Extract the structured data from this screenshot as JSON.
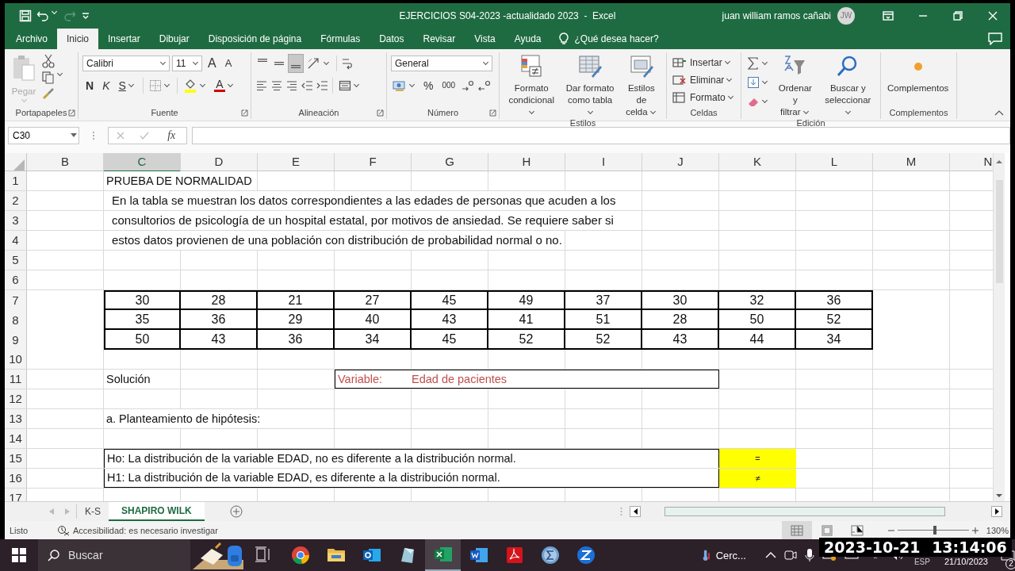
{
  "title_bar": {
    "title": "EJERCICIOS S04-2023 -actualidado 2023  -  Excel",
    "user": "juan william ramos cañabi",
    "avatar": "JW"
  },
  "menu_tabs": [
    {
      "label": "Archivo",
      "selected": false
    },
    {
      "label": "Inicio",
      "selected": true
    },
    {
      "label": "Insertar",
      "selected": false
    },
    {
      "label": "Dibujar",
      "selected": false
    },
    {
      "label": "Disposición de página",
      "selected": false
    },
    {
      "label": "Fórmulas",
      "selected": false
    },
    {
      "label": "Datos",
      "selected": false
    },
    {
      "label": "Revisar",
      "selected": false
    },
    {
      "label": "Vista",
      "selected": false
    },
    {
      "label": "Ayuda",
      "selected": false
    }
  ],
  "tell_me": "¿Qué desea hacer?",
  "ribbon": {
    "groups": [
      {
        "kind": "clipboard",
        "label": "Portapapeles",
        "paste": "Pegar",
        "disabled": true
      },
      {
        "kind": "font",
        "label": "Fuente",
        "font": "Calibri",
        "size": "11",
        "grow": "A",
        "shrink": "A",
        "bold": "N",
        "italic": "K",
        "underline": "S",
        "font_color": "A"
      },
      {
        "kind": "alignment",
        "label": "Alineación",
        "vertical_align": [
          {
            "selected": false
          },
          {
            "selected": false
          },
          {
            "selected": true
          }
        ]
      },
      {
        "kind": "number",
        "label": "Número",
        "format": "General",
        "percent": "%",
        "thousands": "000"
      },
      {
        "kind": "big_buttons",
        "label": "Estilos",
        "buttons": [
          "Formato\ncondicional",
          "Dar formato\ncomo tabla",
          "Estilos de\ncelda"
        ]
      },
      {
        "kind": "cells",
        "label": "Celdas",
        "buttons": [
          "Insertar",
          "Eliminar",
          "Formato"
        ]
      },
      {
        "kind": "editing",
        "label": "Edición",
        "buttons": [
          "Ordenar y\nfiltrar",
          "Buscar y\nseleccionar"
        ]
      },
      {
        "kind": "addins",
        "label": "Complementos",
        "buttons": [
          "Complementos"
        ]
      }
    ]
  },
  "formula_bar": {
    "name_box": "C30",
    "function_button": "fx"
  },
  "sheet": {
    "columns": [
      {
        "label": "B",
        "selected": false
      },
      {
        "label": "C",
        "selected": true
      },
      {
        "label": "D",
        "selected": false
      },
      {
        "label": "E",
        "selected": false
      },
      {
        "label": "F",
        "selected": false
      },
      {
        "label": "G",
        "selected": false
      },
      {
        "label": "H",
        "selected": false
      },
      {
        "label": "I",
        "selected": false
      },
      {
        "label": "J",
        "selected": false
      },
      {
        "label": "K",
        "selected": false
      },
      {
        "label": "L",
        "selected": false
      },
      {
        "label": "M",
        "selected": false
      },
      {
        "label": "N",
        "selected": false
      }
    ],
    "rows": [
      {
        "number": "1",
        "kind": "title",
        "text": "PRUEBA DE NORMALIDAD"
      },
      {
        "number": "2",
        "kind": "paragraph",
        "text": "En la tabla se muestran los datos correspondientes a las edades de personas que acuden a los"
      },
      {
        "number": "3",
        "kind": "paragraph",
        "text": "consultorios de psicología de un hospital estatal, por motivos de ansiedad. Se requiere saber si"
      },
      {
        "number": "4",
        "kind": "paragraph",
        "text": "estos datos provienen de una población con distribución de probabilidad normal o no."
      },
      {
        "number": "5",
        "kind": "empty"
      },
      {
        "number": "6",
        "kind": "empty"
      },
      {
        "number": "7",
        "kind": "numbers",
        "values": [
          "30",
          "28",
          "21",
          "27",
          "45",
          "49",
          "37",
          "30",
          "32",
          "36"
        ]
      },
      {
        "number": "8",
        "kind": "numbers",
        "values": [
          "35",
          "36",
          "29",
          "40",
          "43",
          "41",
          "51",
          "28",
          "50",
          "52"
        ]
      },
      {
        "number": "9",
        "kind": "numbers",
        "values": [
          "50",
          "43",
          "36",
          "34",
          "45",
          "52",
          "52",
          "43",
          "44",
          "34"
        ]
      },
      {
        "number": "10",
        "kind": "empty"
      },
      {
        "number": "11",
        "kind": "variable",
        "text": "Solución",
        "variable_label": "Variable:",
        "variable_value": "Edad de pacientes"
      },
      {
        "number": "12",
        "kind": "empty"
      },
      {
        "number": "13",
        "kind": "title",
        "text": "a. Planteamiento de hipótesis:"
      },
      {
        "number": "14",
        "kind": "empty"
      },
      {
        "number": "15",
        "kind": "hypothesis",
        "text": "Ho: La distribución de la variable EDAD, no es diferente a la distribución normal.",
        "symbol": "="
      },
      {
        "number": "16",
        "kind": "hypothesis",
        "text": "H1: La distribución de la variable EDAD, es diferente a la distribución normal.",
        "symbol": "≠"
      },
      {
        "number": "17",
        "kind": "empty"
      }
    ]
  },
  "sheet_tabs": [
    {
      "label": "K-S",
      "selected": false
    },
    {
      "label": "SHAPIRO WILK",
      "selected": true
    }
  ],
  "status_bar": {
    "state": "Listo",
    "accessibility": "Accesibilidad: es necesario investigar",
    "views": [
      {
        "selected": true
      },
      {
        "selected": false
      },
      {
        "selected": false
      }
    ],
    "zoom": {
      "level": 0.52,
      "reading": "130%"
    }
  },
  "taskbar": {
    "search": {
      "placeholder": "Buscar"
    },
    "weather": "Cerc...",
    "language": "ESP",
    "date": "21/10/2023",
    "notifications": "2"
  },
  "timestamp_overlay": "2023-10-21 13:14:06"
}
